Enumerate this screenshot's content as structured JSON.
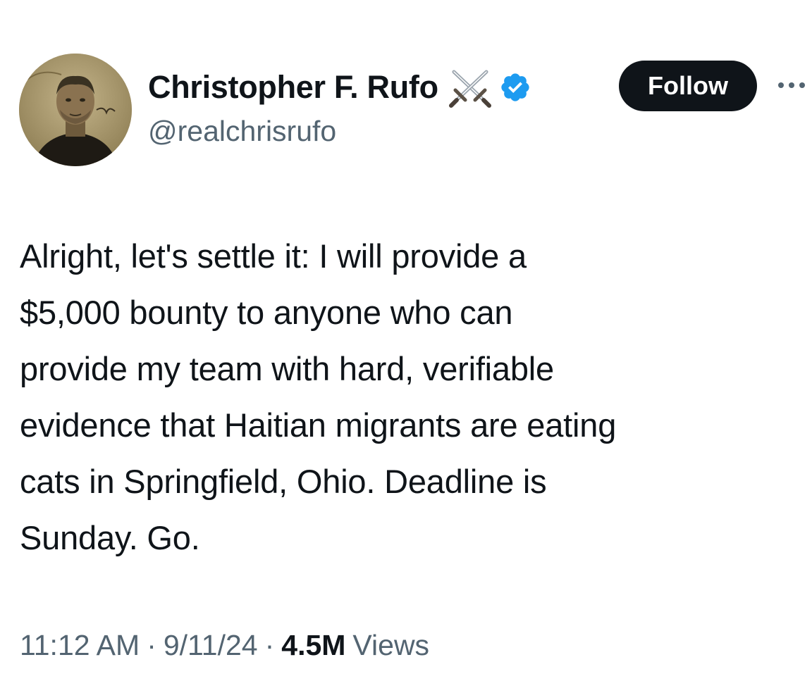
{
  "author": {
    "display_name": "Christopher F. Rufo",
    "handle": "@realchrisrufo",
    "badge_icon": "crossed-swords-icon",
    "verified_icon": "verified-badge-icon",
    "verified_color": "#1d9bf0"
  },
  "actions": {
    "follow_label": "Follow",
    "more_icon": "more-options-icon"
  },
  "tweet": {
    "text": "Alright, let's settle it: I will provide a\n$5,000 bounty to anyone who can\nprovide my team with hard, verifiable\nevidence that Haitian migrants are eating\ncats in Springfield, Ohio. Deadline is\nSunday. Go."
  },
  "meta": {
    "time": "11:12 AM",
    "separator": "·",
    "date": "9/11/24",
    "views_count": "4.5M",
    "views_label": "Views"
  },
  "colors": {
    "text_primary": "#0f1419",
    "text_secondary": "#536471",
    "follow_bg": "#0f1419"
  }
}
